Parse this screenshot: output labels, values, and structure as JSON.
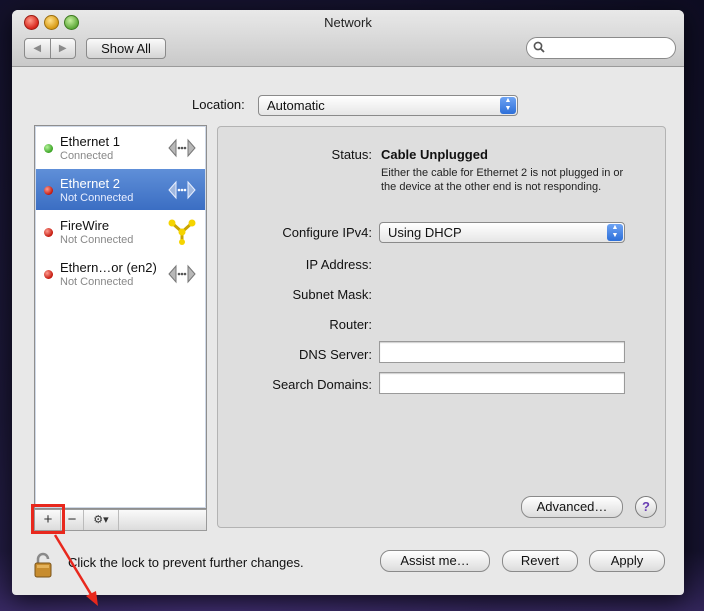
{
  "window": {
    "title": "Network"
  },
  "toolbar": {
    "back": "◀",
    "forward": "▶",
    "show_all": "Show All",
    "search_placeholder": ""
  },
  "location": {
    "label": "Location:",
    "value": "Automatic"
  },
  "services": [
    {
      "name": "Ethernet 1",
      "status": "Connected",
      "dot": "green",
      "icon": "ethernet-icon",
      "selected": false
    },
    {
      "name": "Ethernet 2",
      "status": "Not Connected",
      "dot": "red",
      "icon": "ethernet-icon",
      "selected": true
    },
    {
      "name": "FireWire",
      "status": "Not Connected",
      "dot": "red",
      "icon": "firewire-icon",
      "selected": false
    },
    {
      "name": "Ethern…or (en2)",
      "status": "Not Connected",
      "dot": "red",
      "icon": "ethernet-icon",
      "selected": false
    }
  ],
  "sidebar_buttons": {
    "add": "+",
    "remove": "−",
    "gear": "⚙▾"
  },
  "details": {
    "status_label": "Status:",
    "status_value": "Cable Unplugged",
    "status_desc": "Either the cable for Ethernet 2 is not plugged in or the device at the other end is not responding.",
    "configure_label": "Configure IPv4:",
    "configure_value": "Using DHCP",
    "ip_label": "IP Address:",
    "subnet_label": "Subnet Mask:",
    "router_label": "Router:",
    "dns_label": "DNS Server:",
    "dns_value": "",
    "search_label": "Search Domains:",
    "search_value": "",
    "advanced": "Advanced…",
    "help": "?"
  },
  "footer": {
    "lock_text": "Click the lock to prevent further changes.",
    "assist": "Assist me…",
    "revert": "Revert",
    "apply": "Apply"
  },
  "colors": {
    "selection": "#3b6ec3",
    "annotation": "#e8281d"
  }
}
